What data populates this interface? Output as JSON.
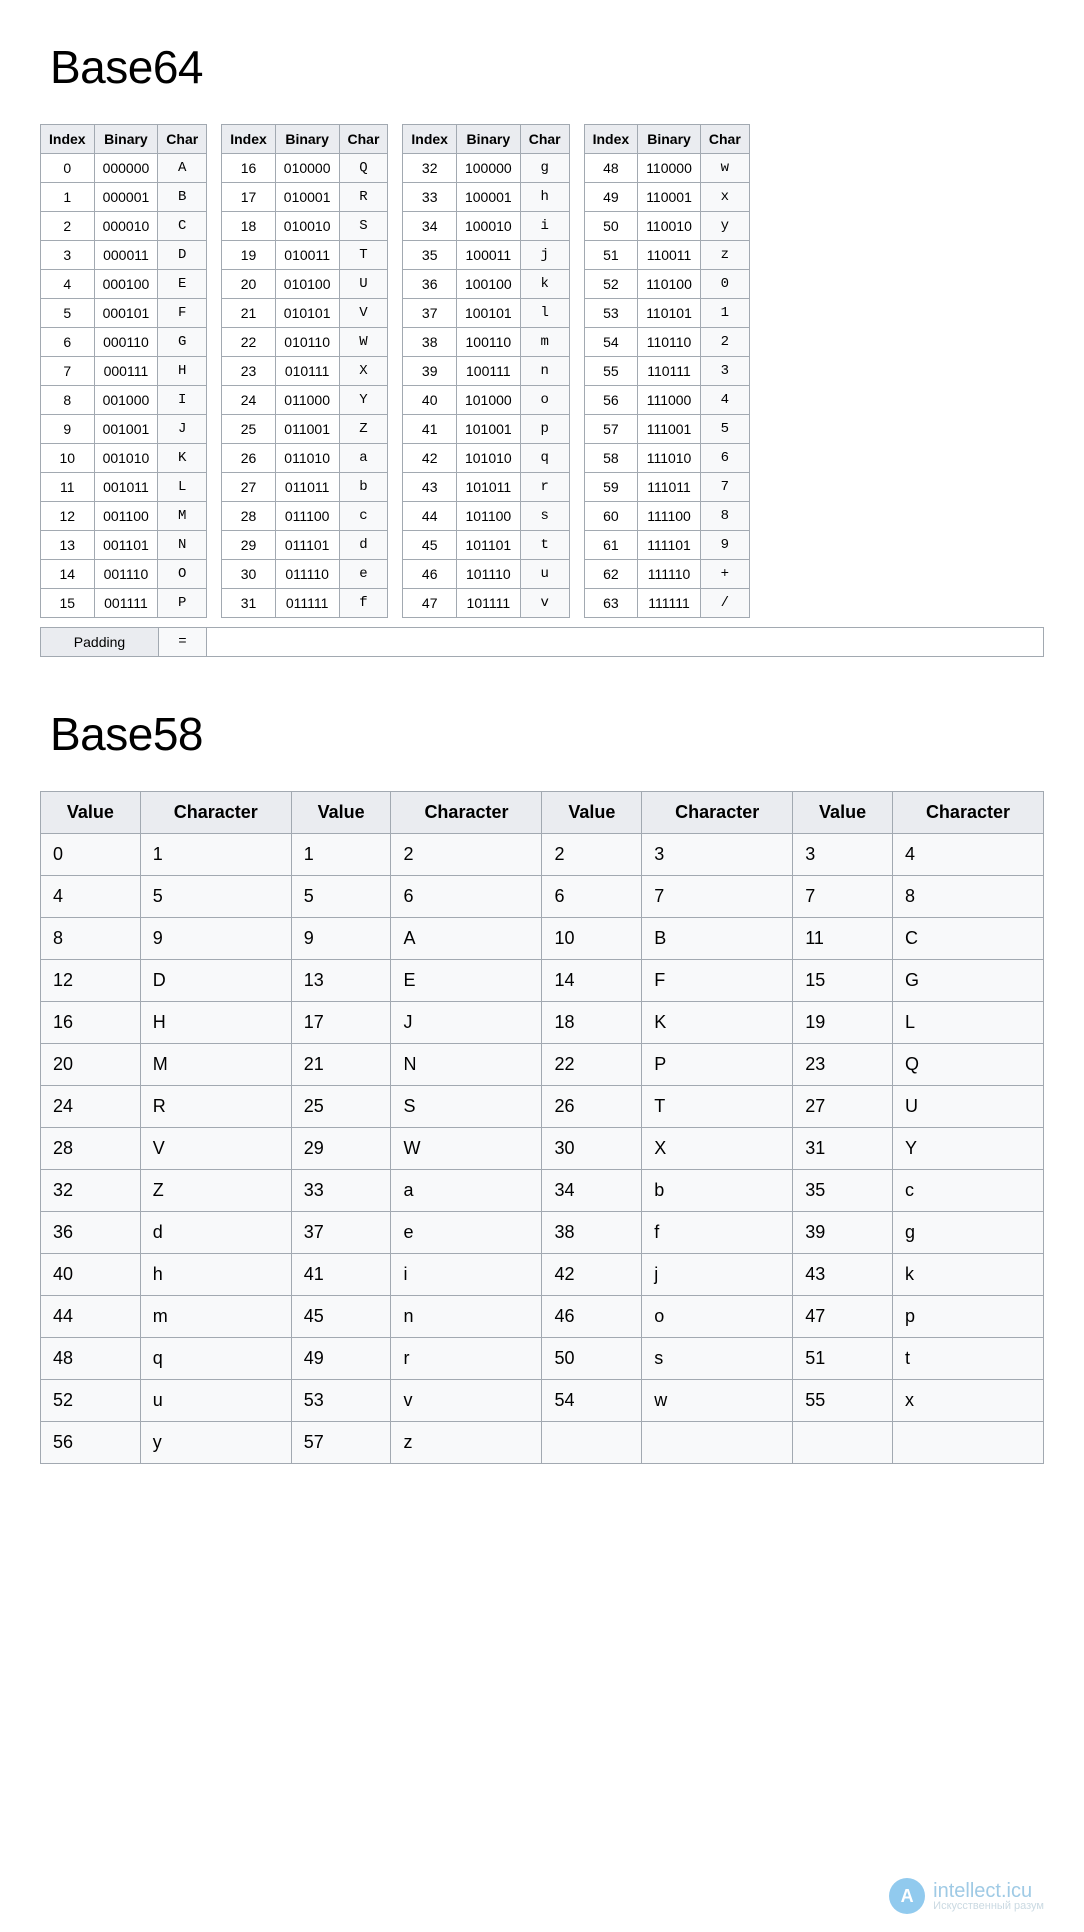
{
  "titles": {
    "base64": "Base64",
    "base58": "Base58"
  },
  "base64": {
    "headers": {
      "index": "Index",
      "binary": "Binary",
      "char": "Char"
    },
    "rows": [
      {
        "index": 0,
        "binary": "000000",
        "char": "A"
      },
      {
        "index": 1,
        "binary": "000001",
        "char": "B"
      },
      {
        "index": 2,
        "binary": "000010",
        "char": "C"
      },
      {
        "index": 3,
        "binary": "000011",
        "char": "D"
      },
      {
        "index": 4,
        "binary": "000100",
        "char": "E"
      },
      {
        "index": 5,
        "binary": "000101",
        "char": "F"
      },
      {
        "index": 6,
        "binary": "000110",
        "char": "G"
      },
      {
        "index": 7,
        "binary": "000111",
        "char": "H"
      },
      {
        "index": 8,
        "binary": "001000",
        "char": "I"
      },
      {
        "index": 9,
        "binary": "001001",
        "char": "J"
      },
      {
        "index": 10,
        "binary": "001010",
        "char": "K"
      },
      {
        "index": 11,
        "binary": "001011",
        "char": "L"
      },
      {
        "index": 12,
        "binary": "001100",
        "char": "M"
      },
      {
        "index": 13,
        "binary": "001101",
        "char": "N"
      },
      {
        "index": 14,
        "binary": "001110",
        "char": "O"
      },
      {
        "index": 15,
        "binary": "001111",
        "char": "P"
      },
      {
        "index": 16,
        "binary": "010000",
        "char": "Q"
      },
      {
        "index": 17,
        "binary": "010001",
        "char": "R"
      },
      {
        "index": 18,
        "binary": "010010",
        "char": "S"
      },
      {
        "index": 19,
        "binary": "010011",
        "char": "T"
      },
      {
        "index": 20,
        "binary": "010100",
        "char": "U"
      },
      {
        "index": 21,
        "binary": "010101",
        "char": "V"
      },
      {
        "index": 22,
        "binary": "010110",
        "char": "W"
      },
      {
        "index": 23,
        "binary": "010111",
        "char": "X"
      },
      {
        "index": 24,
        "binary": "011000",
        "char": "Y"
      },
      {
        "index": 25,
        "binary": "011001",
        "char": "Z"
      },
      {
        "index": 26,
        "binary": "011010",
        "char": "a"
      },
      {
        "index": 27,
        "binary": "011011",
        "char": "b"
      },
      {
        "index": 28,
        "binary": "011100",
        "char": "c"
      },
      {
        "index": 29,
        "binary": "011101",
        "char": "d"
      },
      {
        "index": 30,
        "binary": "011110",
        "char": "e"
      },
      {
        "index": 31,
        "binary": "011111",
        "char": "f"
      },
      {
        "index": 32,
        "binary": "100000",
        "char": "g"
      },
      {
        "index": 33,
        "binary": "100001",
        "char": "h"
      },
      {
        "index": 34,
        "binary": "100010",
        "char": "i"
      },
      {
        "index": 35,
        "binary": "100011",
        "char": "j"
      },
      {
        "index": 36,
        "binary": "100100",
        "char": "k"
      },
      {
        "index": 37,
        "binary": "100101",
        "char": "l"
      },
      {
        "index": 38,
        "binary": "100110",
        "char": "m"
      },
      {
        "index": 39,
        "binary": "100111",
        "char": "n"
      },
      {
        "index": 40,
        "binary": "101000",
        "char": "o"
      },
      {
        "index": 41,
        "binary": "101001",
        "char": "p"
      },
      {
        "index": 42,
        "binary": "101010",
        "char": "q"
      },
      {
        "index": 43,
        "binary": "101011",
        "char": "r"
      },
      {
        "index": 44,
        "binary": "101100",
        "char": "s"
      },
      {
        "index": 45,
        "binary": "101101",
        "char": "t"
      },
      {
        "index": 46,
        "binary": "101110",
        "char": "u"
      },
      {
        "index": 47,
        "binary": "101111",
        "char": "v"
      },
      {
        "index": 48,
        "binary": "110000",
        "char": "w"
      },
      {
        "index": 49,
        "binary": "110001",
        "char": "x"
      },
      {
        "index": 50,
        "binary": "110010",
        "char": "y"
      },
      {
        "index": 51,
        "binary": "110011",
        "char": "z"
      },
      {
        "index": 52,
        "binary": "110100",
        "char": "0"
      },
      {
        "index": 53,
        "binary": "110101",
        "char": "1"
      },
      {
        "index": 54,
        "binary": "110110",
        "char": "2"
      },
      {
        "index": 55,
        "binary": "110111",
        "char": "3"
      },
      {
        "index": 56,
        "binary": "111000",
        "char": "4"
      },
      {
        "index": 57,
        "binary": "111001",
        "char": "5"
      },
      {
        "index": 58,
        "binary": "111010",
        "char": "6"
      },
      {
        "index": 59,
        "binary": "111011",
        "char": "7"
      },
      {
        "index": 60,
        "binary": "111100",
        "char": "8"
      },
      {
        "index": 61,
        "binary": "111101",
        "char": "9"
      },
      {
        "index": 62,
        "binary": "111110",
        "char": "+"
      },
      {
        "index": 63,
        "binary": "111111",
        "char": "/"
      }
    ],
    "padding": {
      "label": "Padding",
      "char": "="
    }
  },
  "base58": {
    "headers": {
      "value": "Value",
      "character": "Character"
    },
    "rows": [
      {
        "value": 0,
        "char": "1"
      },
      {
        "value": 1,
        "char": "2"
      },
      {
        "value": 2,
        "char": "3"
      },
      {
        "value": 3,
        "char": "4"
      },
      {
        "value": 4,
        "char": "5"
      },
      {
        "value": 5,
        "char": "6"
      },
      {
        "value": 6,
        "char": "7"
      },
      {
        "value": 7,
        "char": "8"
      },
      {
        "value": 8,
        "char": "9"
      },
      {
        "value": 9,
        "char": "A"
      },
      {
        "value": 10,
        "char": "B"
      },
      {
        "value": 11,
        "char": "C"
      },
      {
        "value": 12,
        "char": "D"
      },
      {
        "value": 13,
        "char": "E"
      },
      {
        "value": 14,
        "char": "F"
      },
      {
        "value": 15,
        "char": "G"
      },
      {
        "value": 16,
        "char": "H"
      },
      {
        "value": 17,
        "char": "J"
      },
      {
        "value": 18,
        "char": "K"
      },
      {
        "value": 19,
        "char": "L"
      },
      {
        "value": 20,
        "char": "M"
      },
      {
        "value": 21,
        "char": "N"
      },
      {
        "value": 22,
        "char": "P"
      },
      {
        "value": 23,
        "char": "Q"
      },
      {
        "value": 24,
        "char": "R"
      },
      {
        "value": 25,
        "char": "S"
      },
      {
        "value": 26,
        "char": "T"
      },
      {
        "value": 27,
        "char": "U"
      },
      {
        "value": 28,
        "char": "V"
      },
      {
        "value": 29,
        "char": "W"
      },
      {
        "value": 30,
        "char": "X"
      },
      {
        "value": 31,
        "char": "Y"
      },
      {
        "value": 32,
        "char": "Z"
      },
      {
        "value": 33,
        "char": "a"
      },
      {
        "value": 34,
        "char": "b"
      },
      {
        "value": 35,
        "char": "c"
      },
      {
        "value": 36,
        "char": "d"
      },
      {
        "value": 37,
        "char": "e"
      },
      {
        "value": 38,
        "char": "f"
      },
      {
        "value": 39,
        "char": "g"
      },
      {
        "value": 40,
        "char": "h"
      },
      {
        "value": 41,
        "char": "i"
      },
      {
        "value": 42,
        "char": "j"
      },
      {
        "value": 43,
        "char": "k"
      },
      {
        "value": 44,
        "char": "m"
      },
      {
        "value": 45,
        "char": "n"
      },
      {
        "value": 46,
        "char": "o"
      },
      {
        "value": 47,
        "char": "p"
      },
      {
        "value": 48,
        "char": "q"
      },
      {
        "value": 49,
        "char": "r"
      },
      {
        "value": 50,
        "char": "s"
      },
      {
        "value": 51,
        "char": "t"
      },
      {
        "value": 52,
        "char": "u"
      },
      {
        "value": 53,
        "char": "v"
      },
      {
        "value": 54,
        "char": "w"
      },
      {
        "value": 55,
        "char": "x"
      },
      {
        "value": 56,
        "char": "y"
      },
      {
        "value": 57,
        "char": "z"
      }
    ]
  },
  "watermark": {
    "logo_letter": "A",
    "line1": "intellect.icu",
    "line2": "Искусственный разум"
  }
}
